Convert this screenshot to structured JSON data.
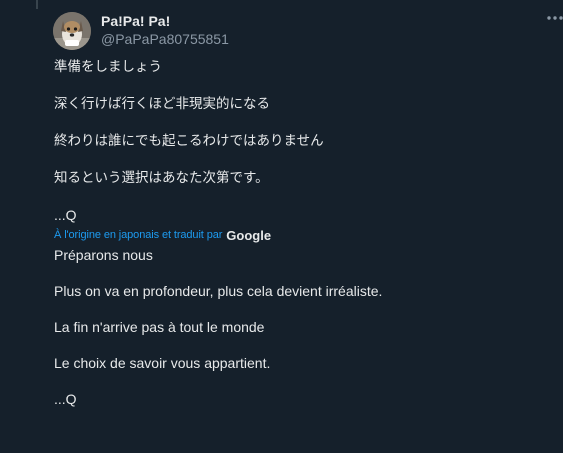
{
  "tweet": {
    "author_name": "Pa!Pa! Pa!",
    "author_handle": "@PaPaPa80755851",
    "more_icon": "more-horizontal-icon",
    "original_lines": [
      "準備をしましょう",
      "深く行けば行くほど非現実的になる",
      "終わりは誰にでも起こるわけではありません",
      "知るという選択はあなた次第です。",
      "...Q"
    ],
    "translation_note": "À l'origine en japonais et traduit par",
    "translation_provider": "Google",
    "translated_lines": [
      "Préparons nous",
      "Plus on va en profondeur, plus cela devient irréaliste.",
      "La fin n'arrive pas à tout le monde",
      "Le choix de savoir vous appartient.",
      "...Q"
    ]
  },
  "colors": {
    "background": "#15202b",
    "text": "#e7e9ea",
    "secondary_text": "#8b98a5",
    "link": "#1d9bf0"
  }
}
